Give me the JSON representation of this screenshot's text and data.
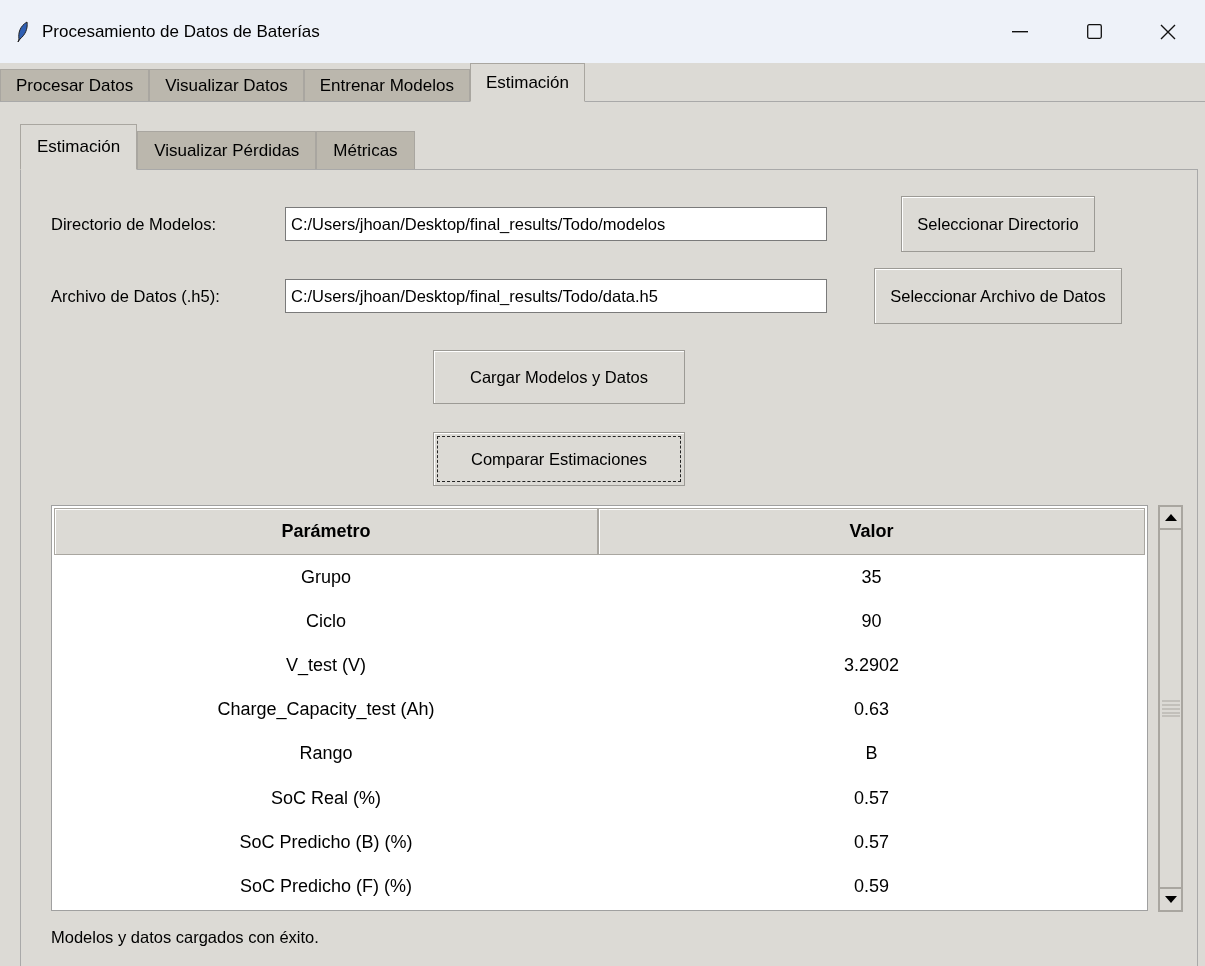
{
  "window": {
    "title": "Procesamiento de Datos de Baterías"
  },
  "tabs": [
    {
      "label": "Procesar Datos",
      "selected": false
    },
    {
      "label": "Visualizar Datos",
      "selected": false
    },
    {
      "label": "Entrenar Modelos",
      "selected": false
    },
    {
      "label": "Estimación",
      "selected": true
    }
  ],
  "subtabs": [
    {
      "label": "Estimación",
      "selected": true
    },
    {
      "label": "Visualizar Pérdidas",
      "selected": false
    },
    {
      "label": "Métricas",
      "selected": false
    }
  ],
  "fields": [
    {
      "label": "Directorio de Modelos:",
      "value": "C:/Users/jhoan/Desktop/final_results/Todo/modelos",
      "button": "Seleccionar Directorio"
    },
    {
      "label": "Archivo de Datos (.h5):",
      "value": "C:/Users/jhoan/Desktop/final_results/Todo/data.h5",
      "button": "Seleccionar Archivo de Datos"
    }
  ],
  "actions": [
    {
      "label": "Cargar Modelos y Datos",
      "focused": false
    },
    {
      "label": "Comparar Estimaciones",
      "focused": true
    }
  ],
  "table": {
    "columns": [
      "Parámetro",
      "Valor"
    ],
    "rows": [
      [
        "Grupo",
        "35"
      ],
      [
        "Ciclo",
        "90"
      ],
      [
        "V_test (V)",
        "3.2902"
      ],
      [
        "Charge_Capacity_test (Ah)",
        "0.63"
      ],
      [
        "Rango",
        "B"
      ],
      [
        "SoC Real (%)",
        "0.57"
      ],
      [
        "SoC Predicho (B) (%)",
        "0.57"
      ],
      [
        "SoC Predicho (F) (%)",
        "0.59"
      ]
    ]
  },
  "status": "Modelos y datos cargados con éxito."
}
